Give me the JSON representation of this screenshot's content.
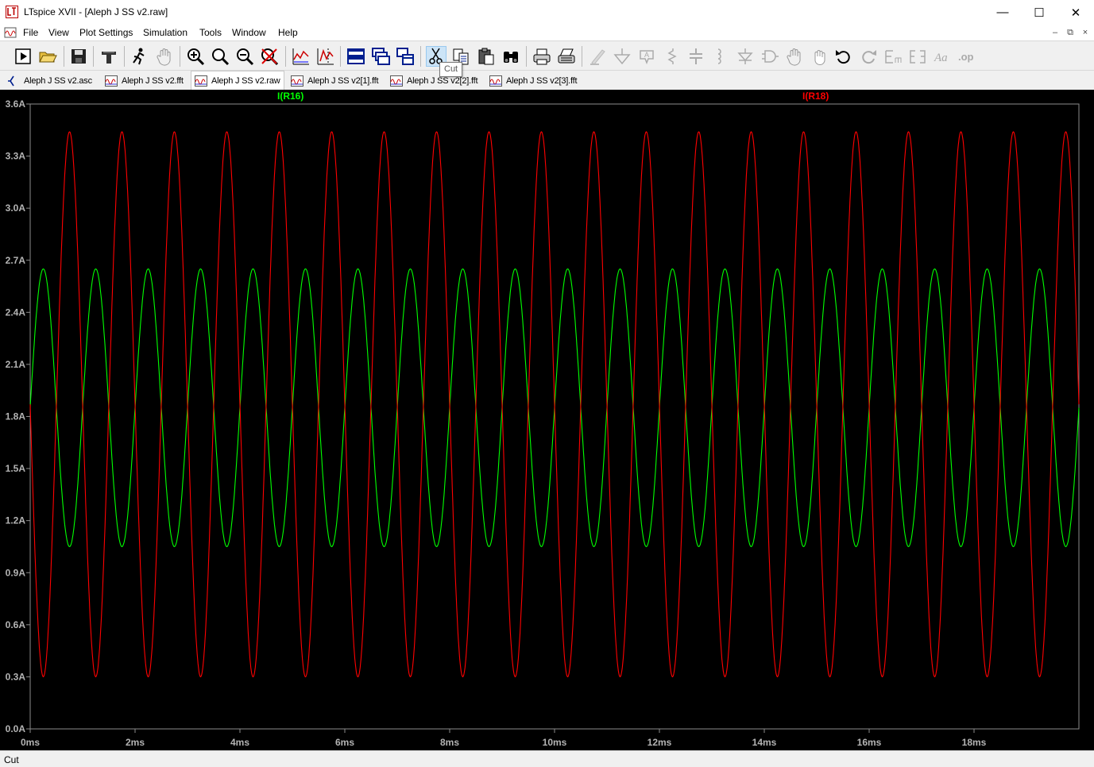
{
  "window": {
    "title": "LTspice XVII - [Aleph J SS v2.raw]",
    "minimize_glyph": "—",
    "maximize_glyph": "☐",
    "close_glyph": "✕"
  },
  "menu": {
    "items": [
      "File",
      "View",
      "Plot Settings",
      "Simulation",
      "Tools",
      "Window",
      "Help"
    ],
    "mdi_minimize": "–",
    "mdi_restore": "⧉",
    "mdi_close": "×"
  },
  "toolbar": {
    "tooltip": "Cut",
    "buttons": [
      "run-icon",
      "open-icon",
      "save-icon",
      "control-panel-icon",
      "halt-icon",
      "pan-icon",
      "zoom-in-icon",
      "zoom-area-icon",
      "zoom-out-icon",
      "zoom-cancel-icon",
      "autorange-icon",
      "mark-unsorted-icon",
      "tile-horizontal-icon",
      "tile-vertical-icon",
      "cascade-icon",
      "cut-icon",
      "copy-icon",
      "paste-icon",
      "find-icon",
      "print-icon",
      "print-setup-icon",
      "wire-icon",
      "ground-icon",
      "label-net-icon",
      "resistor-icon",
      "capacitor-icon",
      "inductor-icon",
      "diode-icon",
      "component-icon",
      "move-icon",
      "drag-icon",
      "undo-icon",
      "redo-icon",
      "rotate-icon",
      "mirror-icon",
      "text-icon",
      "spice-directive-icon"
    ]
  },
  "tabs": [
    {
      "label": "Aleph J SS v2.asc",
      "kind": "schematic",
      "active": false
    },
    {
      "label": "Aleph J SS v2.fft",
      "kind": "waveform",
      "active": false
    },
    {
      "label": "Aleph J SS v2.raw",
      "kind": "waveform",
      "active": true
    },
    {
      "label": "Aleph J SS v2[1].fft",
      "kind": "waveform",
      "active": false
    },
    {
      "label": "Aleph J SS v2[2].fft",
      "kind": "waveform",
      "active": false
    },
    {
      "label": "Aleph J SS v2[3].fft",
      "kind": "waveform",
      "active": false
    }
  ],
  "status": {
    "text": "Cut"
  },
  "colors": {
    "plot_background": "#000000",
    "grid_frame": "#8c8c8c",
    "tick_labels": "#b4b4b4",
    "series_green": "#00ff00",
    "series_red": "#ff0000"
  },
  "chart_data": {
    "type": "line",
    "title": "",
    "xlabel": "",
    "ylabel": "",
    "xlim": [
      0,
      20
    ],
    "x_unit": "ms",
    "ylim": [
      0.0,
      3.6
    ],
    "y_unit": "A",
    "x_ticks": [
      0,
      2,
      4,
      6,
      8,
      10,
      12,
      14,
      16,
      18
    ],
    "x_tick_labels": [
      "0ms",
      "2ms",
      "4ms",
      "6ms",
      "8ms",
      "10ms",
      "12ms",
      "14ms",
      "16ms",
      "18ms"
    ],
    "y_ticks": [
      0.0,
      0.3,
      0.6,
      0.9,
      1.2,
      1.5,
      1.8,
      2.1,
      2.4,
      2.7,
      3.0,
      3.3,
      3.6
    ],
    "y_tick_labels": [
      "0.0A",
      "0.3A",
      "0.6A",
      "0.9A",
      "1.2A",
      "1.5A",
      "1.8A",
      "2.1A",
      "2.4A",
      "2.7A",
      "3.0A",
      "3.3A",
      "3.6A"
    ],
    "grid": false,
    "legend": "top",
    "series": [
      {
        "name": "I(R16)",
        "color": "#00ff00",
        "waveform": "sine",
        "frequency_hz": 1000,
        "offset": 1.85,
        "amplitude": 0.8,
        "min": 1.05,
        "max": 2.65,
        "phase_deg": 0
      },
      {
        "name": "I(R18)",
        "color": "#ff0000",
        "waveform": "sine",
        "frequency_hz": 1000,
        "offset": 1.87,
        "amplitude": 1.57,
        "min": 0.3,
        "max": 3.44,
        "phase_deg": 180
      }
    ]
  }
}
